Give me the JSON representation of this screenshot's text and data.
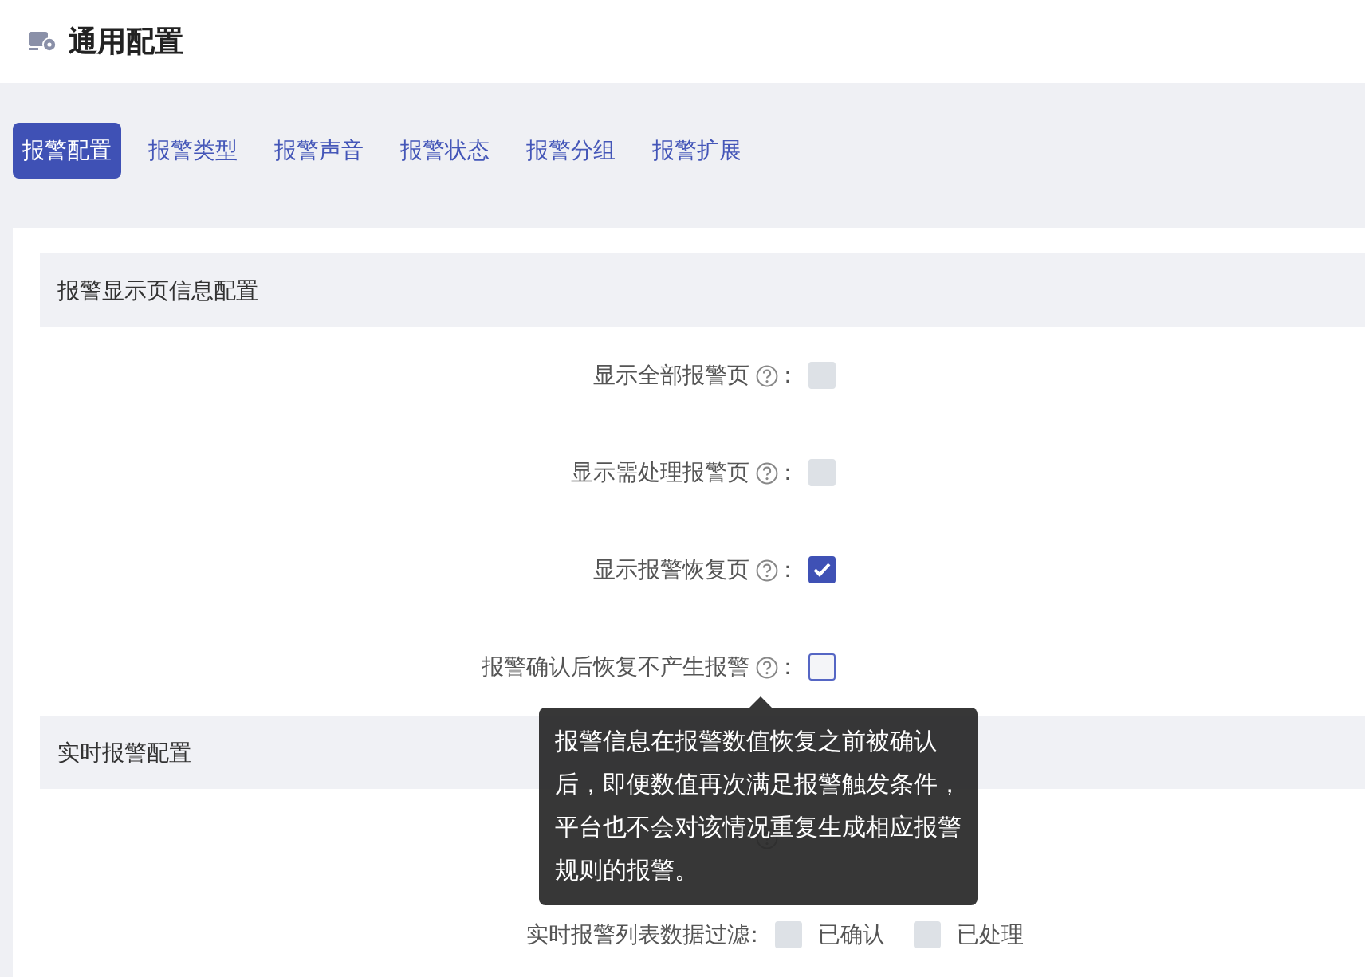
{
  "page_title": "通用配置",
  "tabs": [
    {
      "label": "报警配置",
      "selected": true
    },
    {
      "label": "报警类型",
      "selected": false
    },
    {
      "label": "报警声音",
      "selected": false
    },
    {
      "label": "报警状态",
      "selected": false
    },
    {
      "label": "报警分组",
      "selected": false
    },
    {
      "label": "报警扩展",
      "selected": false
    }
  ],
  "sections": [
    {
      "title": "报警显示页信息配置",
      "rows": [
        {
          "kind": "single",
          "label": "显示全部报警页",
          "help": true,
          "separator": "：",
          "checked": false,
          "disabled": true
        },
        {
          "kind": "single",
          "label": "显示需处理报警页",
          "help": true,
          "separator": "：",
          "checked": false,
          "disabled": true
        },
        {
          "kind": "single",
          "label": "显示报警恢复页",
          "help": true,
          "separator": "：",
          "checked": true,
          "disabled": false
        },
        {
          "kind": "single",
          "label": "报警确认后恢复不产生报警",
          "help": true,
          "separator": "：",
          "checked": false,
          "disabled": false
        }
      ]
    },
    {
      "title": "实时报警配置",
      "rows": [
        {
          "kind": "covered",
          "help": true
        },
        {
          "kind": "multi",
          "label": "实时报警列表数据过滤",
          "separator": "：",
          "options": [
            {
              "label": "已确认",
              "checked": false,
              "disabled": true
            },
            {
              "label": "已处理",
              "checked": false,
              "disabled": true
            }
          ]
        }
      ]
    }
  ],
  "tooltip": {
    "text": "报警信息在报警数值恢复之前被确认后，即便数值再次满足报警触发条件，平台也不会对该情况重复生成相应报警规则的报警。"
  }
}
